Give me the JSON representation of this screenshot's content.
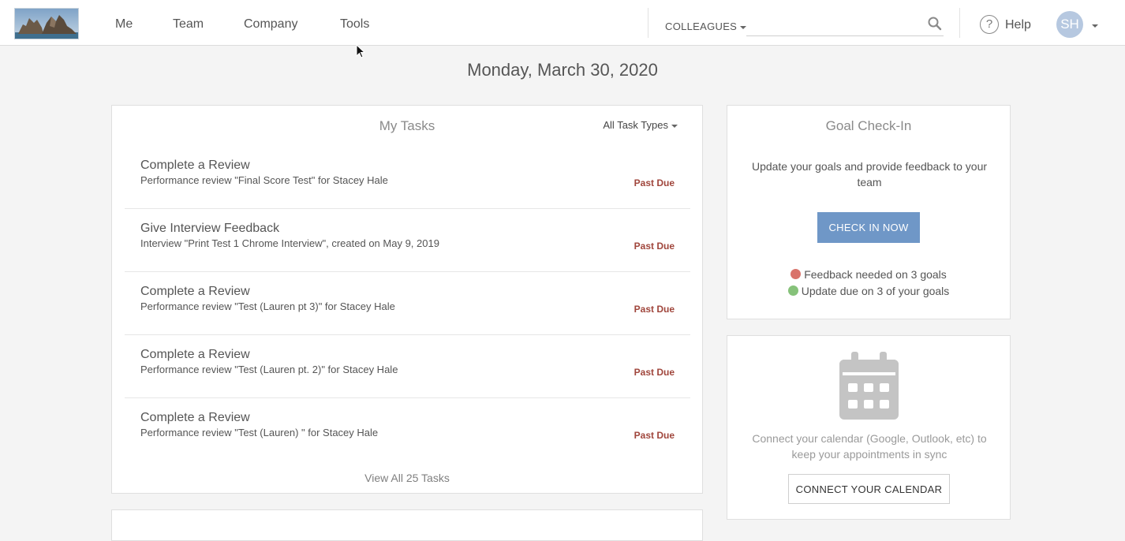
{
  "nav": {
    "items": [
      {
        "label": "Me"
      },
      {
        "label": "Team"
      },
      {
        "label": "Company"
      },
      {
        "label": "Tools"
      }
    ],
    "colleagues_label": "COLLEAGUES",
    "search_placeholder": "",
    "help_label": "Help",
    "user_initials": "SH"
  },
  "date_title": "Monday, March 30, 2020",
  "tasks": {
    "title": "My Tasks",
    "filter_label": "All Task Types",
    "items": [
      {
        "title": "Complete a Review",
        "subtitle": "Performance review \"Final Score Test\" for Stacey Hale",
        "status": "Past Due"
      },
      {
        "title": "Give Interview Feedback",
        "subtitle": "Interview \"Print Test 1 Chrome Interview\", created on May 9, 2019",
        "status": "Past Due"
      },
      {
        "title": "Complete a Review",
        "subtitle": "Performance review \"Test (Lauren pt 3)\" for Stacey Hale",
        "status": "Past Due"
      },
      {
        "title": "Complete a Review",
        "subtitle": "Performance review \"Test (Lauren pt. 2)\" for Stacey Hale",
        "status": "Past Due"
      },
      {
        "title": "Complete a Review",
        "subtitle": "Performance review \"Test (Lauren) \" for Stacey Hale",
        "status": "Past Due"
      }
    ],
    "view_all_label": "View All 25 Tasks"
  },
  "goal_checkin": {
    "title": "Goal Check-In",
    "description": "Update your goals and provide feedback to your team",
    "button_label": "CHECK IN NOW",
    "feedback_line": "Feedback needed on 3 goals",
    "update_line": "Update due on 3 of your goals"
  },
  "calendar": {
    "description": "Connect your calendar (Google, Outlook, etc) to keep your appointments in sync",
    "button_label": "CONNECT YOUR CALENDAR"
  },
  "colors": {
    "accent_button": "#6f97c7",
    "past_due": "#a0463c",
    "feedback_dot": "#d9736b",
    "update_dot": "#86c27a",
    "avatar_bg": "#b6c8e0"
  },
  "icons": {
    "search": "search-icon",
    "help": "help-icon",
    "calendar": "calendar-icon",
    "caret": "caret-down-icon"
  }
}
